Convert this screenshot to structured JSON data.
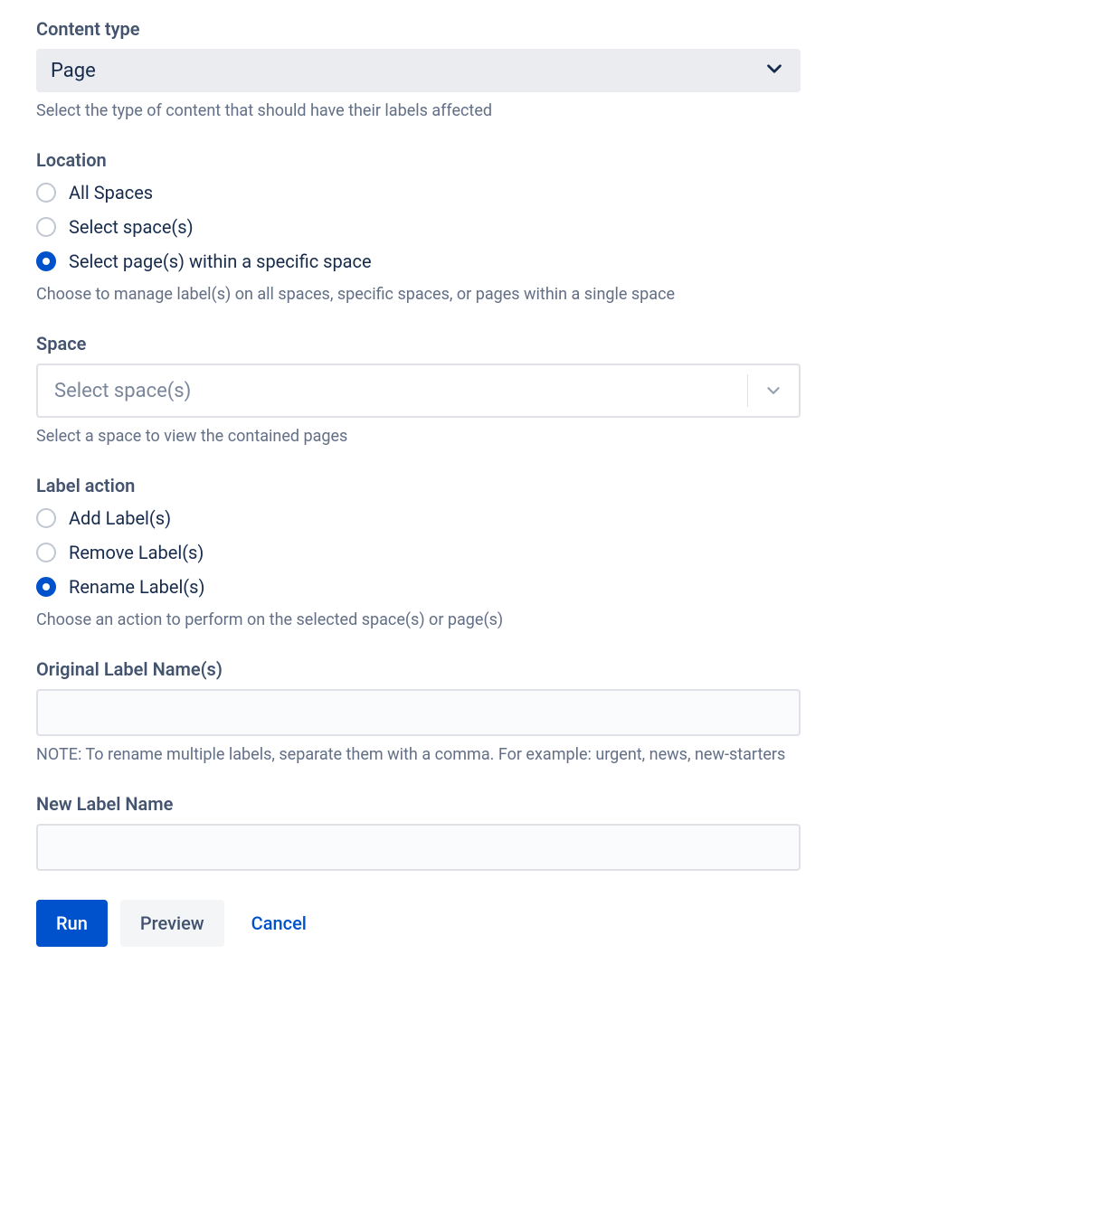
{
  "contentType": {
    "label": "Content type",
    "value": "Page",
    "help": "Select the type of content that should have their labels affected"
  },
  "location": {
    "label": "Location",
    "options": [
      {
        "label": "All Spaces",
        "selected": false
      },
      {
        "label": "Select space(s)",
        "selected": false
      },
      {
        "label": "Select page(s) within a specific space",
        "selected": true
      }
    ],
    "help": "Choose to manage label(s) on all spaces, specific spaces, or pages within a single space"
  },
  "space": {
    "label": "Space",
    "placeholder": "Select space(s)",
    "help": "Select a space to view the contained pages"
  },
  "labelAction": {
    "label": "Label action",
    "options": [
      {
        "label": "Add Label(s)",
        "selected": false
      },
      {
        "label": "Remove Label(s)",
        "selected": false
      },
      {
        "label": "Rename Label(s)",
        "selected": true
      }
    ],
    "help": "Choose an action to perform on the selected space(s) or page(s)"
  },
  "originalLabel": {
    "label": "Original Label Name(s)",
    "value": "",
    "help": "NOTE: To rename multiple labels, separate them with a comma. For example: urgent, news, new-starters"
  },
  "newLabel": {
    "label": "New Label Name",
    "value": ""
  },
  "buttons": {
    "run": "Run",
    "preview": "Preview",
    "cancel": "Cancel"
  }
}
